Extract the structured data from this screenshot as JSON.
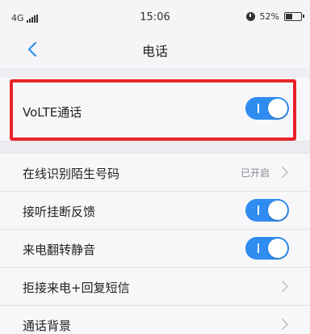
{
  "status_bar": {
    "network": "4G",
    "time": "15:06",
    "battery_text": "52%",
    "battery_level": 0.52,
    "icons": [
      "signal-icon",
      "alarm-icon",
      "battery-icon"
    ]
  },
  "nav": {
    "title": "电话",
    "back_icon": "chevron-left-icon"
  },
  "settings": {
    "volte": {
      "label": "VoLTE通话",
      "enabled": true
    },
    "items": [
      {
        "label": "在线识别陌生号码",
        "value": "已开启",
        "type": "link"
      },
      {
        "label": "接听挂断反馈",
        "enabled": true,
        "type": "toggle"
      },
      {
        "label": "来电翻转静音",
        "enabled": true,
        "type": "toggle"
      },
      {
        "label": "拒接来电+回复短信",
        "type": "link"
      },
      {
        "label": "通话背景",
        "type": "link"
      }
    ]
  },
  "colors": {
    "accent": "#2f8cf0",
    "highlight": "#e8232a",
    "background": "#eeeef2"
  }
}
